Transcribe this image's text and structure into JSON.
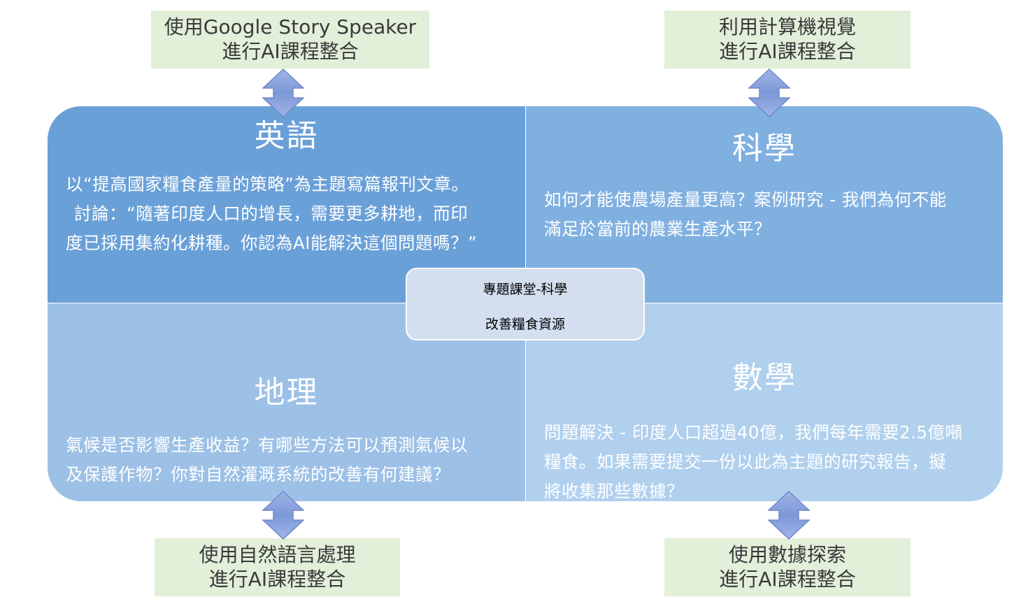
{
  "colors": {
    "quad_top_left": "#6aa0d8",
    "quad_top_right": "#80b0e0",
    "quad_bottom_left": "#9cc0e6",
    "quad_bottom_right": "#b0d0ee",
    "center_box": "#d3deef",
    "ai_box": "#e2efd9",
    "arrow": "#8aa2dc"
  },
  "center": {
    "line1": "專題課堂-科學",
    "line2": "改善糧食資源"
  },
  "quadrants": {
    "english": {
      "title": "英語",
      "lines": [
        "以“提高國家糧食產量的策略”為主題寫篇報刊文章。",
        "討論：“隨著印度人口的增長，需要更多耕地，而印",
        "度已採用集約化耕種。你認為AI能解決這個問題嗎？”"
      ]
    },
    "science": {
      "title": "科學",
      "lines": [
        "如何才能使農場產量更高？案例研究 - 我們為何不能",
        "滿足於當前的農業生產水平？"
      ]
    },
    "geography": {
      "title": "地理",
      "lines": [
        "氣候是否影響生產收益？有哪些方法可以預測氣候以",
        "及保護作物？你對自然灌溉系統的改善有何建議？"
      ]
    },
    "math": {
      "title": "數學",
      "lines": [
        "問題解決 - 印度人口超過40億，我們每年需要2.5億噸",
        "糧食。如果需要提交一份以此為主題的研究報告，擬",
        "將收集那些數據？"
      ]
    }
  },
  "ai_boxes": {
    "top_left": {
      "line1": "使用Google Story Speaker",
      "line2": "進行AI課程整合"
    },
    "top_right": {
      "line1": "利用計算機視覺",
      "line2": "進行AI課程整合"
    },
    "bottom_left": {
      "line1": "使用自然語言處理",
      "line2": "進行AI課程整合"
    },
    "bottom_right": {
      "line1": "使用數據探索",
      "line2": "進行AI課程整合"
    }
  },
  "icons": {
    "arrow": "up-down-arrow-icon"
  }
}
